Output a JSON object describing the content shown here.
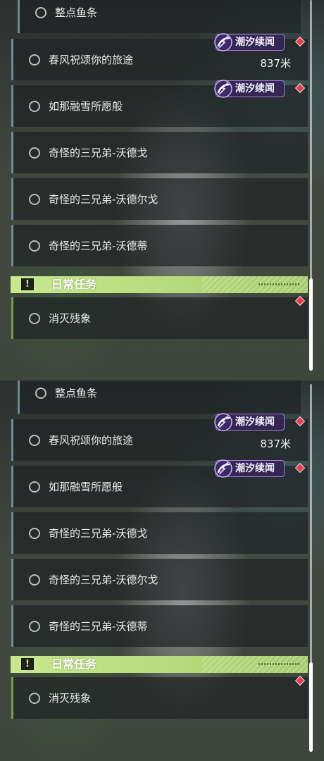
{
  "panels": [
    {
      "quests": [
        {
          "title": "整点鱼条"
        },
        {
          "title": "春风祝颂你的旅途",
          "distance": "837米",
          "tag": "潮汐续闻"
        },
        {
          "title": "如那融雪所愿般",
          "tag": "潮汐续闻"
        },
        {
          "title": "奇怪的三兄弟-沃德戈"
        },
        {
          "title": "奇怪的三兄弟-沃德尔戈"
        },
        {
          "title": "奇怪的三兄弟-沃德蒂"
        }
      ],
      "section": {
        "title": "日常任务",
        "alert_symbol": "!"
      },
      "daily_quests": [
        {
          "title": "消灭残象"
        }
      ]
    },
    {
      "quests": [
        {
          "title": "整点鱼条"
        },
        {
          "title": "春风祝颂你的旅途",
          "distance": "837米",
          "tag": "潮汐续闻"
        },
        {
          "title": "如那融雪所愿般",
          "tag": "潮汐续闻"
        },
        {
          "title": "奇怪的三兄弟-沃德戈"
        },
        {
          "title": "奇怪的三兄弟-沃德尔戈"
        },
        {
          "title": "奇怪的三兄弟-沃德蒂"
        }
      ],
      "section": {
        "title": "日常任务",
        "alert_symbol": "!"
      },
      "daily_quests": [
        {
          "title": "消灭残象"
        }
      ]
    }
  ],
  "colors": {
    "tag_border": "#a27cd8",
    "tag_fill": "#34265a",
    "diamond_marker": "#e0404f",
    "daily_header": "#c8e88f"
  },
  "icons": {
    "radio": "quest-radio-icon",
    "tag": "tide-swirl-icon",
    "marker": "diamond-marker-icon",
    "alert": "alert-icon"
  }
}
